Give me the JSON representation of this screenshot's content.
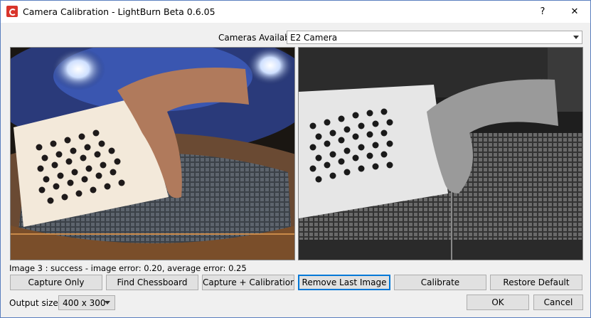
{
  "window": {
    "title": "Camera Calibration - LightBurn Beta 0.6.05",
    "help_label": "?",
    "close_label": "✕"
  },
  "cameras": {
    "label": "Cameras Available:",
    "selected": "E2 Camera"
  },
  "status": "Image 3 : success - image error: 0.20, average error: 0.25",
  "buttons": {
    "capture_only": "Capture Only",
    "find_chessboard": "Find Chessboard",
    "capture_calibration": "Capture + Calibration",
    "remove_last_image": "Remove Last Image",
    "calibrate": "Calibrate",
    "restore_default": "Restore Default",
    "ok": "OK",
    "cancel": "Cancel"
  },
  "output_size": {
    "label": "Output size:",
    "selected": "400 x 300"
  },
  "colors": {
    "accent": "#0078d7",
    "app_icon": "#d9342b"
  }
}
